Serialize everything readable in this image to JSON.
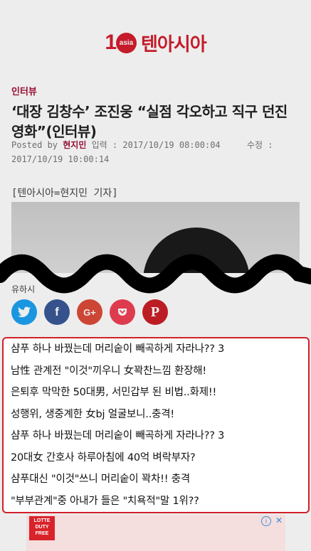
{
  "logo": {
    "number": "1",
    "badge": "asia",
    "text": "텐아시아"
  },
  "article": {
    "section": "인터뷰",
    "title": "‘대장 김창수’ 조진웅 “실점 각오하고 직구 던진 영화”(인터뷰)",
    "posted_by_label": "Posted by",
    "author": "현지민",
    "input_label": "입력 :",
    "input_time": "2017/10/19 08:00:04",
    "modified_label": "수정 :",
    "modified_time": "2017/10/19 10:00:14",
    "byline": "[텐아시아=현지민 기자]"
  },
  "share": {
    "caption": "유하시",
    "buttons": [
      {
        "name": "twitter",
        "icon": "twitter-icon",
        "color": "#1da1f2"
      },
      {
        "name": "facebook",
        "icon": "facebook-icon",
        "color": "#3b5998"
      },
      {
        "name": "google-plus",
        "icon": "google-plus-icon",
        "color": "#dd4b39"
      },
      {
        "name": "pocket",
        "icon": "pocket-icon",
        "color": "#ef4056"
      },
      {
        "name": "pinterest",
        "icon": "pinterest-icon",
        "color": "#cb2027"
      }
    ]
  },
  "ad_popup": {
    "border_color": "#d0202a",
    "items": [
      "샴푸 하나 바꿨는데 머리숱이 빼곡하게 자라나?? 3",
      "남性 관계전 \"이것\"끼우니 女꽉찬느낌 환장해!",
      "은퇴후 막막한 50대男, 서민갑부 된 비법..화제!!",
      "성행위, 생중계한 女bj 얼굴보니..충격!",
      "샴푸 하나 바꿨는데 머리숱이 빼곡하게 자라나?? 3",
      "20대女 간호사 하루아침에 40억 벼락부자?",
      "샴푸대신 \"이것\"쓰니 머리숱이 꽉차!! 충격",
      "\"부부관계\"중 아내가 들은 \"치욕적\"말 1위??"
    ]
  },
  "bottom_ad": {
    "brand_lines": [
      "LOTTE",
      "DUTY",
      "FREE"
    ],
    "info_icon": "info-icon",
    "close_icon": "close-icon"
  },
  "colors": {
    "brand": "#d41e2e",
    "accent": "#a3123a"
  }
}
